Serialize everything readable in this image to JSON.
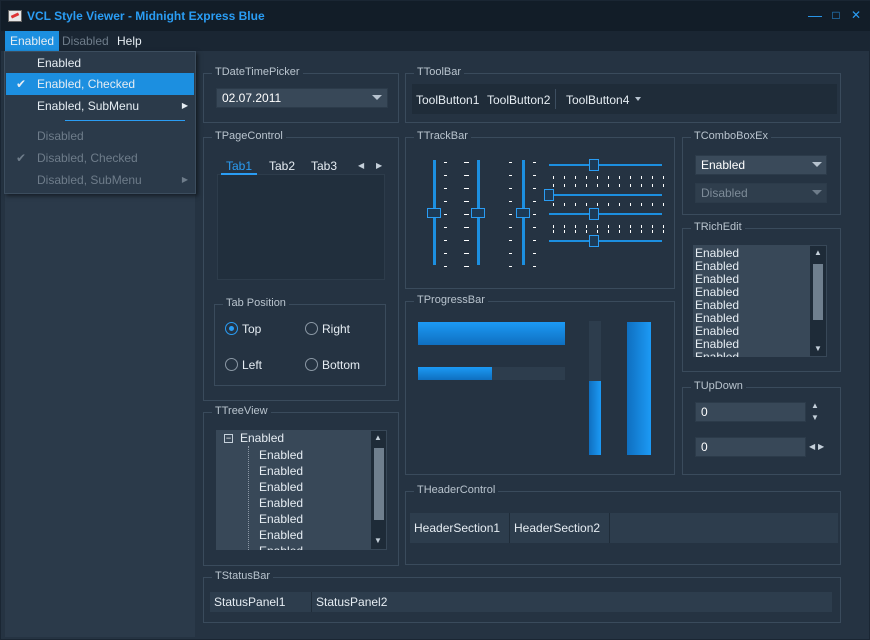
{
  "title": "VCL Style Viewer - Midnight Express Blue",
  "window_buttons": {
    "min": "—",
    "max": "□",
    "close": "✕"
  },
  "menu": {
    "enabled": "Enabled",
    "disabled": "Disabled",
    "help": "Help"
  },
  "dropdown": {
    "items": [
      "Enabled",
      "Enabled, Checked",
      "Enabled, SubMenu",
      "Disabled",
      "Disabled, Checked",
      "Disabled, SubMenu"
    ],
    "check": "✔",
    "submenu_arrow": "▶"
  },
  "datetime": {
    "label": "TDateTimePicker",
    "value": "02.07.2011"
  },
  "toolbar": {
    "label": "TToolBar",
    "buttons": [
      "ToolButton1",
      "ToolButton2",
      "ToolButton4"
    ]
  },
  "pagecontrol": {
    "label": "TPageControl",
    "tabs": [
      "Tab1",
      "Tab2",
      "Tab3"
    ]
  },
  "tabposition": {
    "label": "Tab Position",
    "options": [
      "Top",
      "Right",
      "Left",
      "Bottom"
    ],
    "selected": "Top"
  },
  "trackbar": {
    "label": "TTrackBar",
    "vertical_levels": [
      0.5,
      0.5,
      0.5
    ],
    "horizontal_levels": [
      0.4,
      0,
      0.4,
      0.4
    ]
  },
  "comboboxex": {
    "label": "TComboBoxEx",
    "enabled_value": "Enabled",
    "disabled_value": "Disabled"
  },
  "richedit": {
    "label": "TRichEdit",
    "lines": [
      "Enabled",
      "Enabled",
      "Enabled",
      "Enabled",
      "Enabled",
      "Enabled",
      "Enabled",
      "Enabled",
      "Enabled",
      "Enabled"
    ]
  },
  "progressbar": {
    "label": "TProgressBar",
    "values": [
      1.0,
      0.5,
      0.55,
      1.0
    ]
  },
  "updown": {
    "label": "TUpDown",
    "values": [
      "0",
      "0"
    ]
  },
  "treeview": {
    "label": "TTreeView",
    "root": "Enabled",
    "children": [
      "Enabled",
      "Enabled",
      "Enabled",
      "Enabled",
      "Enabled",
      "Enabled",
      "Enabled"
    ],
    "collapse": "−"
  },
  "headercontrol": {
    "label": "THeaderControl",
    "sections": [
      "HeaderSection1",
      "HeaderSection2"
    ]
  },
  "statusbar": {
    "label": "TStatusBar",
    "panels": [
      "StatusPanel1",
      "StatusPanel2"
    ]
  },
  "colors": {
    "accent": "#2a9df4",
    "background": "#253342",
    "selected": "#1c8fe0"
  }
}
